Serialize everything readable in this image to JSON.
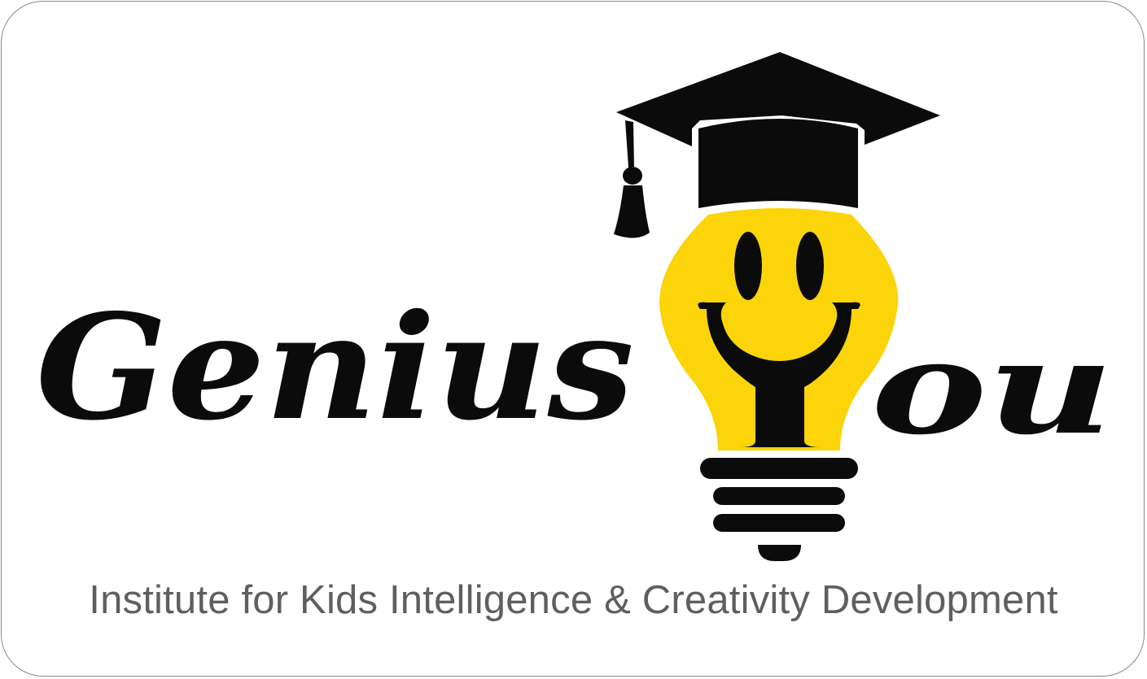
{
  "logo": {
    "word_left": "Genius",
    "word_right": "ou",
    "tagline": "Institute for Kids Intelligence & Creativity Development",
    "icons": [
      "graduation-cap-icon",
      "lightbulb-icon",
      "smiley-face-icon"
    ],
    "colors": {
      "text": "#0b0b0b",
      "bulb": "#fbd40a",
      "tagline": "#5f5f5f",
      "border": "#8a8a8a",
      "background": "#ffffff"
    }
  }
}
